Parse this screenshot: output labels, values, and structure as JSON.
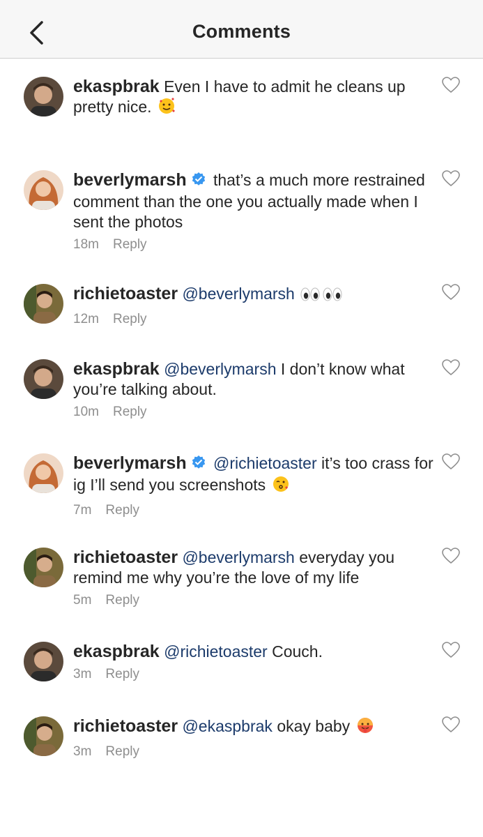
{
  "header": {
    "title": "Comments",
    "back_icon": "chevron-left-icon"
  },
  "comments": [
    {
      "username": "ekaspbrak",
      "verified": false,
      "mention": "",
      "text": "Even I have to admit he cleans up pretty nice.",
      "emoji": "smiling-face-with-hearts",
      "time": "",
      "reply": ""
    },
    {
      "username": "beverlymarsh",
      "verified": true,
      "mention": "",
      "text": "that’s a much more restrained comment than the one you actually made when I sent the photos",
      "emoji": "",
      "time": "18m",
      "reply": "Reply"
    },
    {
      "username": "richietoaster",
      "verified": false,
      "mention": "@beverlymarsh",
      "text": "",
      "emoji": "eyes-eyes",
      "time": "12m",
      "reply": "Reply"
    },
    {
      "username": "ekaspbrak",
      "verified": false,
      "mention": "@beverlymarsh",
      "text": "I don’t know what you’re talking about.",
      "emoji": "",
      "time": "10m",
      "reply": "Reply"
    },
    {
      "username": "beverlymarsh",
      "verified": true,
      "mention": "@richietoaster",
      "text": "it’s too crass for ig I’ll send you screenshots",
      "emoji": "face-blowing-kiss",
      "time": "7m",
      "reply": "Reply"
    },
    {
      "username": "richietoaster",
      "verified": false,
      "mention": "@beverlymarsh",
      "text": "everyday you remind me why you’re the love of my life",
      "emoji": "",
      "time": "5m",
      "reply": "Reply"
    },
    {
      "username": "ekaspbrak",
      "verified": false,
      "mention": "@richietoaster",
      "text": "Couch.",
      "emoji": "",
      "time": "3m",
      "reply": "Reply"
    },
    {
      "username": "richietoaster",
      "verified": false,
      "mention": "@ekaspbrak",
      "text": "okay baby",
      "emoji": "hot-face",
      "time": "3m",
      "reply": "Reply"
    }
  ],
  "colors": {
    "mention": "#1c3b6b",
    "meta": "#8e8e8e",
    "verified": "#3897f0",
    "text": "#262626"
  }
}
